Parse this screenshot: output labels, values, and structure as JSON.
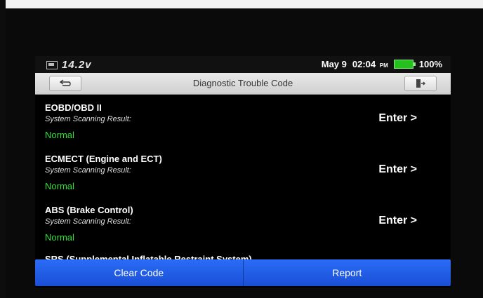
{
  "status_bar": {
    "voltage": "14.2v",
    "date": "May 9",
    "time": "02:04",
    "time_suffix": "PM",
    "battery_percent": "100%"
  },
  "title_bar": {
    "title": "Diagnostic Trouble Code",
    "back_icon": "back-arrow-icon",
    "exit_icon": "exit-icon"
  },
  "systems": [
    {
      "name": "EOBD/OBD II",
      "subtitle": "System Scanning Result:",
      "status": "Normal",
      "action": "Enter >"
    },
    {
      "name": "ECMECT (Engine and ECT)",
      "subtitle": "System Scanning Result:",
      "status": "Normal",
      "action": "Enter >"
    },
    {
      "name": "ABS (Brake Control)",
      "subtitle": "System Scanning Result:",
      "status": "Normal",
      "action": "Enter >"
    }
  ],
  "partial_item": "SRS (Supplemental Inflatable Restraint System)",
  "bottom_bar": {
    "clear_label": "Clear Code",
    "report_label": "Report"
  },
  "colors": {
    "status_normal": "#2ee03a",
    "bottom_bar": "#2b6cf6"
  }
}
